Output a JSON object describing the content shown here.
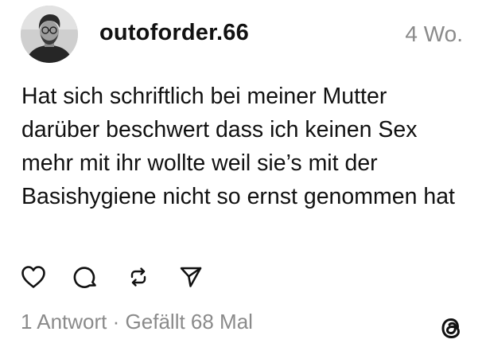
{
  "post": {
    "username": "outoforder.66",
    "timestamp": "4 Wo.",
    "text": "Hat sich schriftlich bei meiner Mutter darüber beschwert dass ich keinen Sex mehr mit ihr wollte weil sie’s mit der Basishygiene nicht so ernst genommen hat"
  },
  "actions": {
    "like_icon": "heart-icon",
    "reply_icon": "comment-icon",
    "repost_icon": "repost-icon",
    "share_icon": "send-icon"
  },
  "stats": {
    "replies": "1 Antwort",
    "separator": "·",
    "likes": "Gefällt 68 Mal"
  },
  "branding": {
    "logo_icon": "threads-logo-icon"
  },
  "colors": {
    "text": "#111111",
    "muted": "#8a8a8a",
    "background": "#ffffff"
  }
}
